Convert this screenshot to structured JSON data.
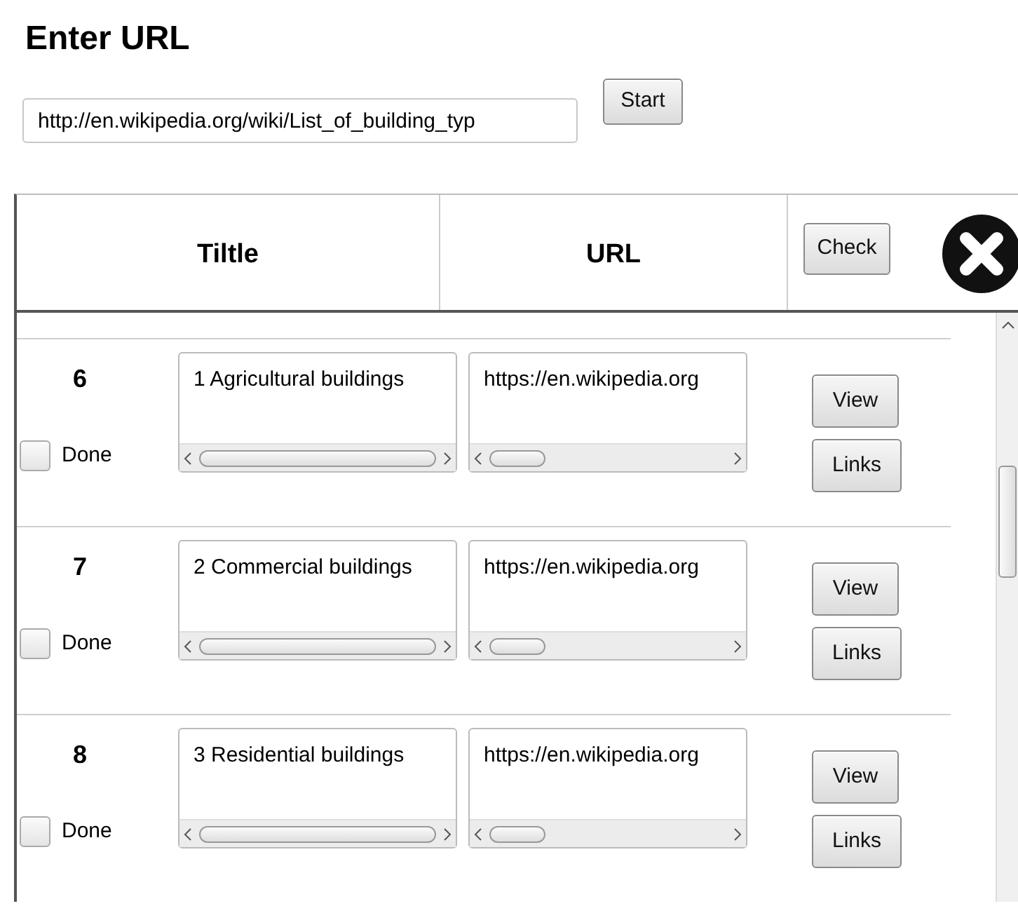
{
  "heading": "Enter URL",
  "url_input": {
    "value": "http://en.wikipedia.org/wiki/List_of_building_typ"
  },
  "start_button": "Start",
  "table": {
    "columns": [
      "Tiltle",
      "URL"
    ],
    "check_button": "Check",
    "rows": [
      {
        "number": "6",
        "done": {
          "label": "Done",
          "checked": false
        },
        "title": "1 Agricultural buildings",
        "url": "https://en.wikipedia.org",
        "view": "View",
        "links": "Links"
      },
      {
        "number": "7",
        "done": {
          "label": "Done",
          "checked": false
        },
        "title": "2 Commercial buildings",
        "url": "https://en.wikipedia.org",
        "view": "View",
        "links": "Links"
      },
      {
        "number": "8",
        "done": {
          "label": "Done",
          "checked": false
        },
        "title": "3 Residential buildings",
        "url": "https://en.wikipedia.org",
        "view": "View",
        "links": "Links"
      }
    ]
  }
}
